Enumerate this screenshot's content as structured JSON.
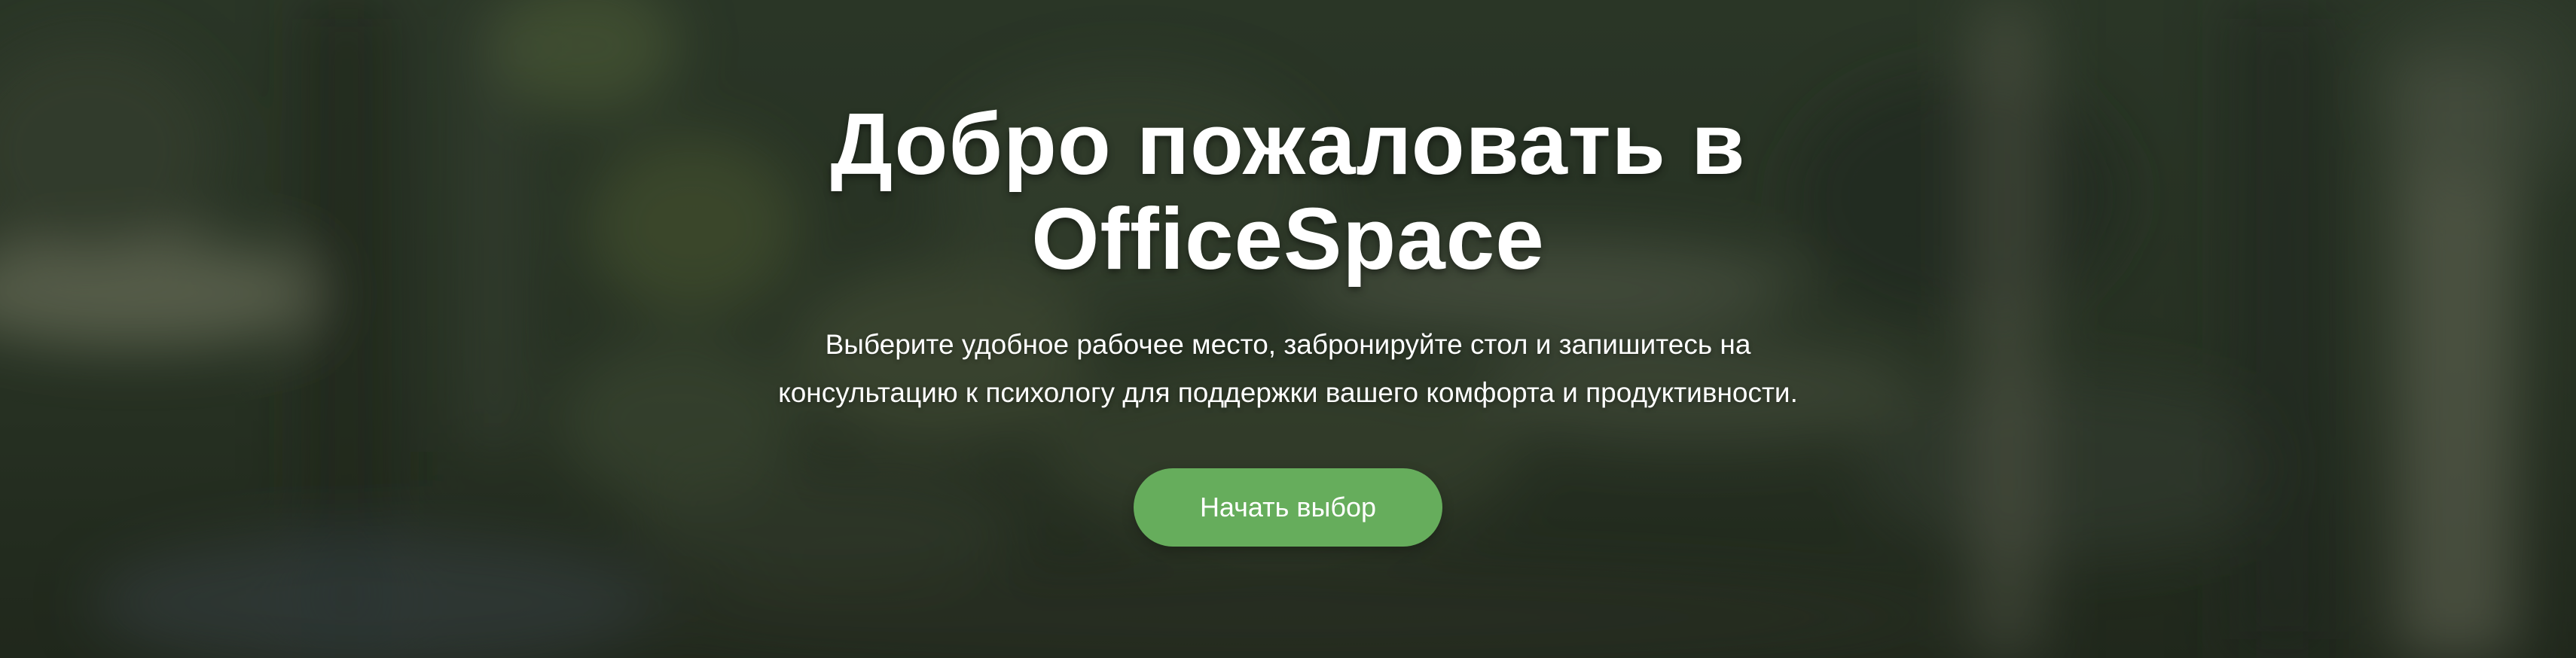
{
  "hero": {
    "title": "Добро пожаловать в OfficeSpace",
    "subtitle": "Выберите удобное рабочее место, забронируйте стол и запишитесь на консультацию к психологу для поддержки вашего комфорта и продуктивности.",
    "cta_label": "Начать выбор"
  },
  "colors": {
    "cta_background": "#66ad5c",
    "text": "#ffffff",
    "background_tint": "#2e3a2c"
  }
}
